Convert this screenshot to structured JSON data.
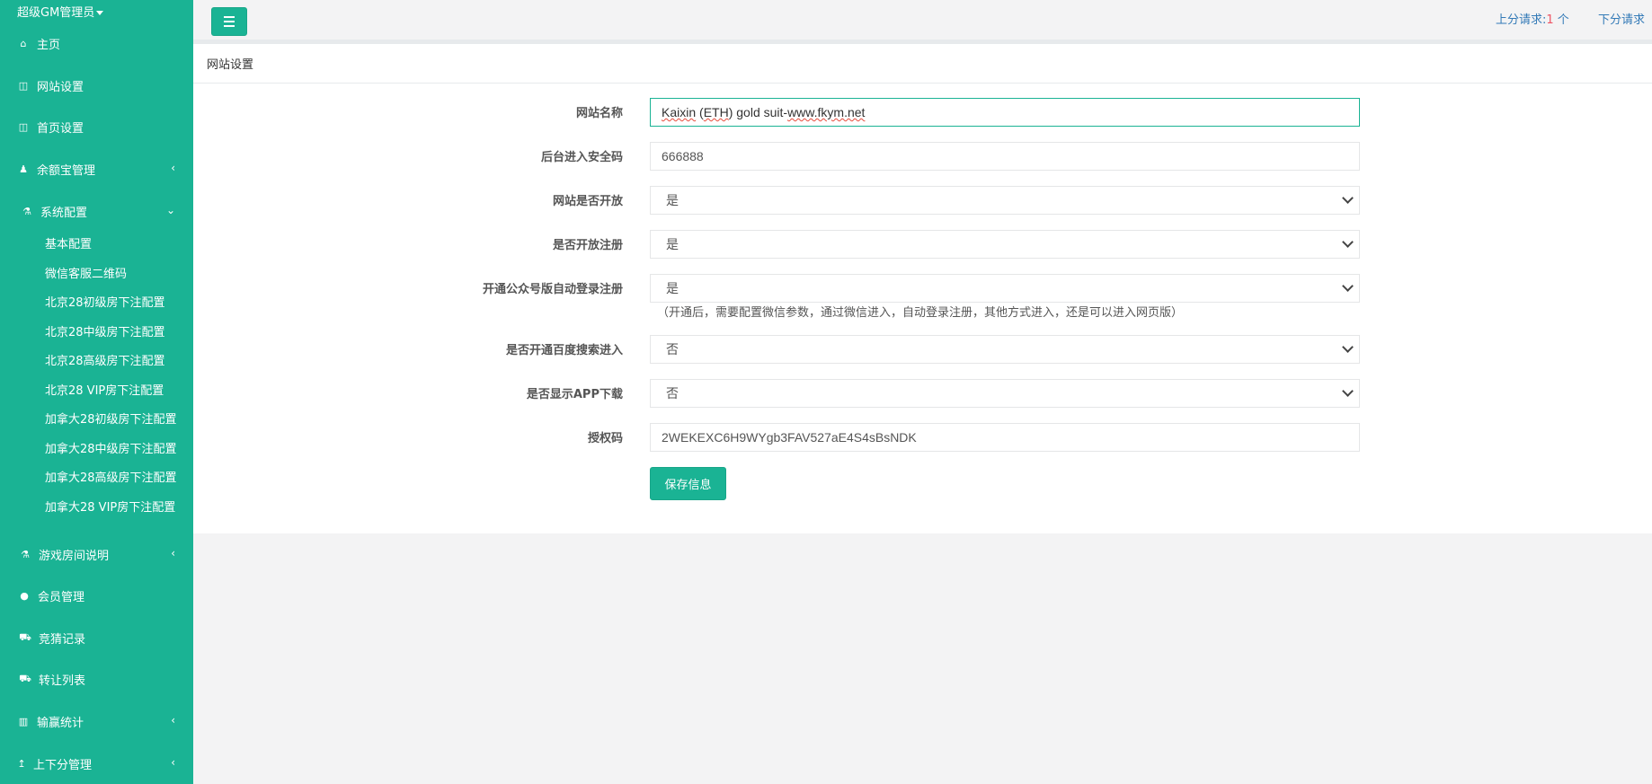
{
  "sidebar": {
    "user_label": "超级GM管理员",
    "items": [
      {
        "label": "主页",
        "icon": "home-icon",
        "glyph": "⌂"
      },
      {
        "label": "网站设置",
        "icon": "columns-icon",
        "glyph": "◫"
      },
      {
        "label": "首页设置",
        "icon": "columns-icon",
        "glyph": "◫"
      },
      {
        "label": "余额宝管理",
        "icon": "male-icon",
        "glyph": "♟"
      },
      {
        "label": "系统配置",
        "icon": "flask-icon",
        "glyph": "⚗"
      },
      {
        "label": "游戏房间说明",
        "icon": "flask-icon",
        "glyph": "⚗"
      },
      {
        "label": "会员管理",
        "icon": "user-icon",
        "glyph": "●"
      },
      {
        "label": "竞猜记录",
        "icon": "car-icon",
        "glyph": "⛟"
      },
      {
        "label": "转让列表",
        "icon": "car-icon",
        "glyph": "⛟"
      },
      {
        "label": "输赢统计",
        "icon": "bar-chart-icon",
        "glyph": "▥"
      },
      {
        "label": "上下分管理",
        "icon": "level-up-icon",
        "glyph": "↥"
      }
    ],
    "sub_items": [
      "基本配置",
      "微信客服二维码",
      "北京28初级房下注配置",
      "北京28中级房下注配置",
      "北京28高级房下注配置",
      "北京28 VIP房下注配置",
      "加拿大28初级房下注配置",
      "加拿大28中级房下注配置",
      "加拿大28高级房下注配置",
      "加拿大28 VIP房下注配置"
    ]
  },
  "topbar": {
    "up_request_label": "上分请求:",
    "up_request_count": "1",
    "up_request_unit": " 个",
    "down_request_label": "下分请求"
  },
  "panel": {
    "title": "网站设置",
    "fields": [
      {
        "label": "网站名称",
        "value_parts": [
          "Kaixin",
          " (",
          "ETH",
          ") gold suit-",
          "www.fkym.net"
        ]
      },
      {
        "label": "后台进入安全码",
        "value": "666888"
      },
      {
        "label": "网站是否开放",
        "value": "是"
      },
      {
        "label": "是否开放注册",
        "value": "是"
      },
      {
        "label": "开通公众号版自动登录注册",
        "value": "是"
      },
      {
        "label": "是否开通百度搜索进入",
        "value": "否"
      },
      {
        "label": "是否显示APP下载",
        "value": "否"
      },
      {
        "label": "授权码",
        "value": "2WEKEXC6H9WYgb3FAV527aE4S4sBsNDK"
      }
    ],
    "hint": "（开通后，需要配置微信参数，通过微信进入，自动登录注册，其他方式进入，还是可以进入网页版）",
    "save_label": "保存信息"
  }
}
